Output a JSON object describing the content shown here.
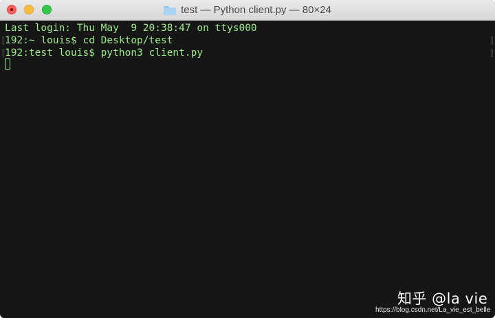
{
  "window": {
    "title": "test — Python client.py — 80×24",
    "title_icon": "folder-icon"
  },
  "terminal": {
    "lines": [
      "Last login: Thu May  9 20:38:47 on ttys000",
      "192:~ louis$ cd Desktop/test",
      "192:test louis$ python3 client.py"
    ],
    "mark_left": "[",
    "mark_right": "]"
  },
  "watermark": {
    "brand": "知乎 @la vie",
    "url": "https://blog.csdn.net/La_vie_est_belle"
  },
  "colors": {
    "terminal_bg": "#161616",
    "terminal_text": "#9bec86"
  }
}
